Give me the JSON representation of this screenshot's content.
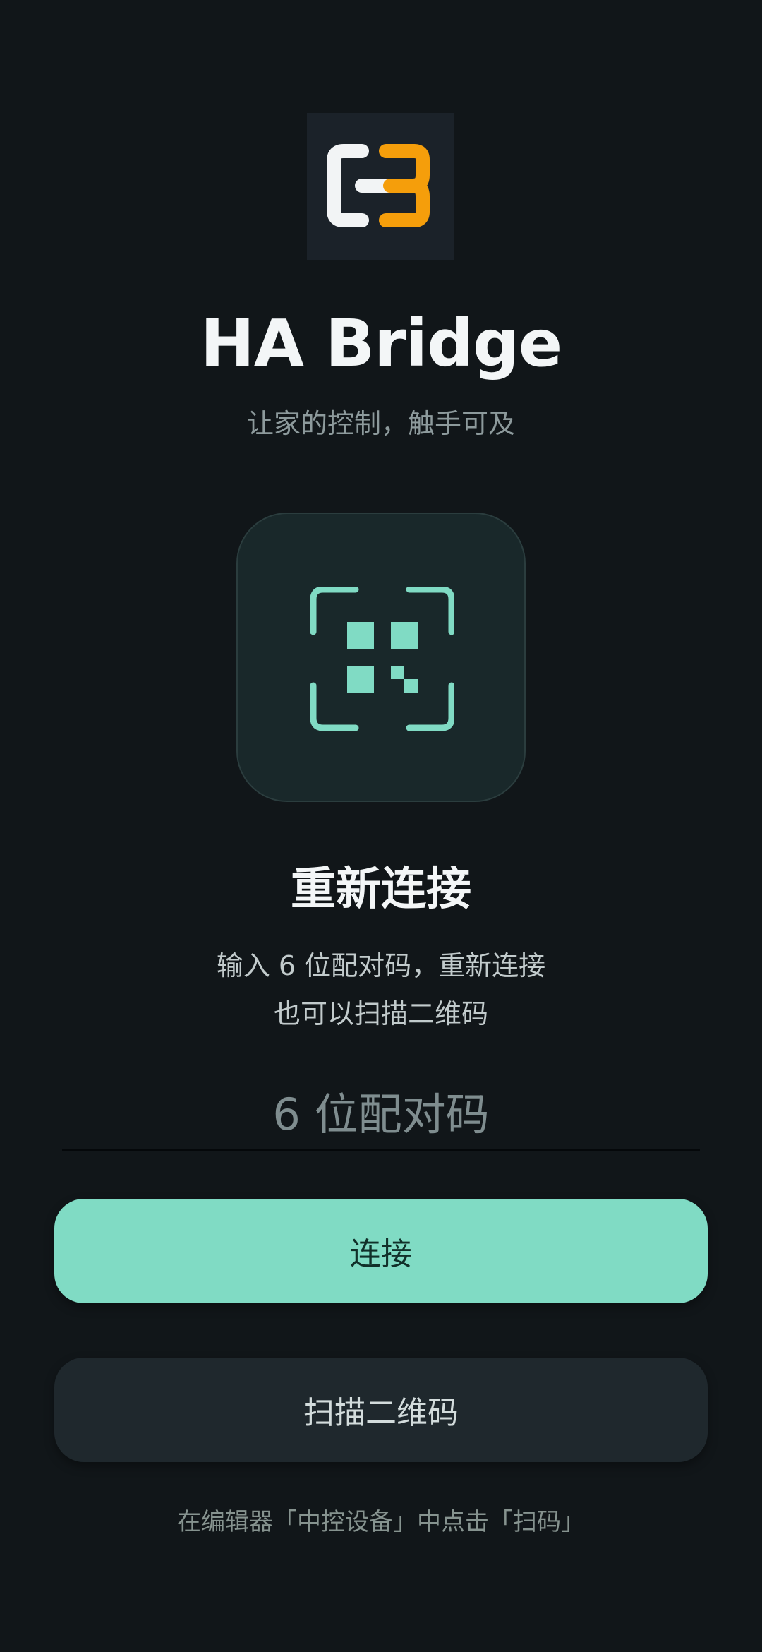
{
  "app": {
    "logo_icon": "c3-logo-icon",
    "title": "HA Bridge",
    "tagline": "让家的控制，触手可及"
  },
  "illustration": {
    "icon": "qr-scan-icon"
  },
  "reconnect": {
    "title": "重新连接",
    "description_line1": "输入 6 位配对码，重新连接",
    "description_line2": "也可以扫描二维码"
  },
  "pairing_code": {
    "value": "",
    "placeholder": "6 位配对码"
  },
  "buttons": {
    "connect_label": "连接",
    "scan_label": "扫描二维码"
  },
  "footer": {
    "hint": "在编辑器「中控设备」中点击「扫码」"
  },
  "colors": {
    "background": "#111619",
    "accent": "#80dbc4",
    "logo_white": "#f2f4f5",
    "logo_orange": "#f59e0b"
  }
}
